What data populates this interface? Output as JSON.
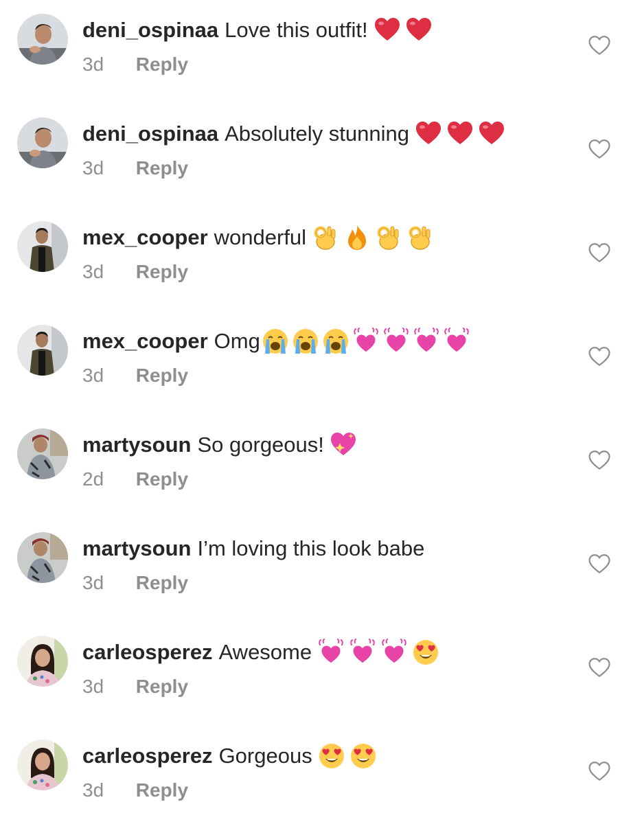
{
  "comments": [
    {
      "username": "deni_ospinaa",
      "text": "Love this outfit!",
      "emojis": [
        "red-heart",
        "red-heart"
      ],
      "time": "3d",
      "reply": "Reply",
      "avatar": "male-1"
    },
    {
      "username": "deni_ospinaa",
      "text": "Absolutely stunning",
      "emojis": [
        "red-heart",
        "red-heart",
        "red-heart"
      ],
      "time": "3d",
      "reply": "Reply",
      "avatar": "male-1"
    },
    {
      "username": "mex_cooper",
      "text": "wonderful",
      "emojis": [
        "ok-hand",
        "fire",
        "ok-hand",
        "ok-hand"
      ],
      "time": "3d",
      "reply": "Reply",
      "avatar": "male-2"
    },
    {
      "username": "mex_cooper",
      "text": "Omg",
      "emojis": [
        "loudly-crying-face",
        "loudly-crying-face",
        "loudly-crying-face",
        "beating-heart",
        "beating-heart",
        "beating-heart",
        "beating-heart"
      ],
      "time": "3d",
      "reply": "Reply",
      "avatar": "male-2"
    },
    {
      "username": "martysoun",
      "text": "So gorgeous!",
      "emojis": [
        "sparkling-heart"
      ],
      "time": "2d",
      "reply": "Reply",
      "avatar": "male-3"
    },
    {
      "username": "martysoun",
      "text": "I’m loving this look babe",
      "emojis": [],
      "time": "3d",
      "reply": "Reply",
      "avatar": "male-3"
    },
    {
      "username": "carleosperez",
      "text": "Awesome",
      "emojis": [
        "beating-heart",
        "beating-heart",
        "beating-heart",
        "heart-eyes-face"
      ],
      "time": "3d",
      "reply": "Reply",
      "avatar": "female-1"
    },
    {
      "username": "carleosperez",
      "text": "Gorgeous",
      "emojis": [
        "heart-eyes-face",
        "heart-eyes-face"
      ],
      "time": "3d",
      "reply": "Reply",
      "avatar": "female-1"
    }
  ],
  "colors": {
    "text": "#262626",
    "muted": "#8e8e8e",
    "like_outline": "#8e8e8e",
    "heart_red": "#dd2e44",
    "pink_heart": "#e844a8",
    "emoji_yellow": "#ffcc4d"
  },
  "icons": {
    "like": "heart-outline-icon"
  }
}
